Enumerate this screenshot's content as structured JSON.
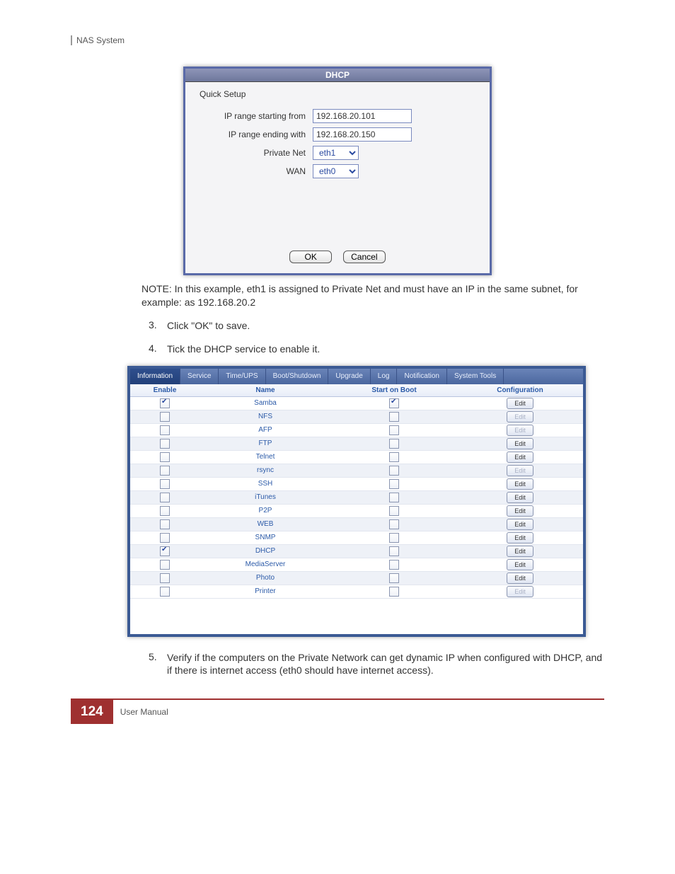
{
  "header": "NAS System",
  "dialog": {
    "title": "DHCP",
    "subtitle": "Quick Setup",
    "rows": {
      "ip_start_label": "IP range starting from",
      "ip_start_value": "192.168.20.101",
      "ip_end_label": "IP range ending with",
      "ip_end_value": "192.168.20.150",
      "private_label": "Private Net",
      "private_value": "eth1",
      "wan_label": "WAN",
      "wan_value": "eth0"
    },
    "ok": "OK",
    "cancel": "Cancel"
  },
  "note": "NOTE: In this example, eth1 is assigned to Private Net and must have an IP in the same subnet, for example: as 192.168.20.2",
  "steps": {
    "s3n": "3.",
    "s3": "Click \"OK\" to save.",
    "s4n": "4.",
    "s4": "Tick the DHCP service to enable it.",
    "s5n": "5.",
    "s5": "Verify if the computers on the Private Network can get dynamic IP when configured with DHCP, and if there is internet access (eth0 should have internet access)."
  },
  "svc": {
    "tabs": [
      "Information",
      "Service",
      "Time/UPS",
      "Boot/Shutdown",
      "Upgrade",
      "Log",
      "Notification",
      "System Tools"
    ],
    "headers": {
      "en": "Enable",
      "nm": "Name",
      "sb": "Start on Boot",
      "cf": "Configuration"
    },
    "rows": [
      {
        "name": "Samba",
        "en": true,
        "sb": true,
        "edit": "Edit",
        "disabled": false
      },
      {
        "name": "NFS",
        "en": false,
        "sb": false,
        "edit": "Edit",
        "disabled": true
      },
      {
        "name": "AFP",
        "en": false,
        "sb": false,
        "edit": "Edit",
        "disabled": true
      },
      {
        "name": "FTP",
        "en": false,
        "sb": false,
        "edit": "Edit",
        "disabled": false
      },
      {
        "name": "Telnet",
        "en": false,
        "sb": false,
        "edit": "Edit",
        "disabled": false
      },
      {
        "name": "rsync",
        "en": false,
        "sb": false,
        "edit": "Edit",
        "disabled": true
      },
      {
        "name": "SSH",
        "en": false,
        "sb": false,
        "edit": "Edit",
        "disabled": false
      },
      {
        "name": "iTunes",
        "en": false,
        "sb": false,
        "edit": "Edit",
        "disabled": false
      },
      {
        "name": "P2P",
        "en": false,
        "sb": false,
        "edit": "Edit",
        "disabled": false
      },
      {
        "name": "WEB",
        "en": false,
        "sb": false,
        "edit": "Edit",
        "disabled": false
      },
      {
        "name": "SNMP",
        "en": false,
        "sb": false,
        "edit": "Edit",
        "disabled": false
      },
      {
        "name": "DHCP",
        "en": true,
        "sb": false,
        "edit": "Edit",
        "disabled": false
      },
      {
        "name": "MediaServer",
        "en": false,
        "sb": false,
        "edit": "Edit",
        "disabled": false
      },
      {
        "name": "Photo",
        "en": false,
        "sb": false,
        "edit": "Edit",
        "disabled": false
      },
      {
        "name": "Printer",
        "en": false,
        "sb": false,
        "edit": "Edit",
        "disabled": true
      }
    ]
  },
  "footer": {
    "page": "124",
    "text": "User Manual"
  }
}
